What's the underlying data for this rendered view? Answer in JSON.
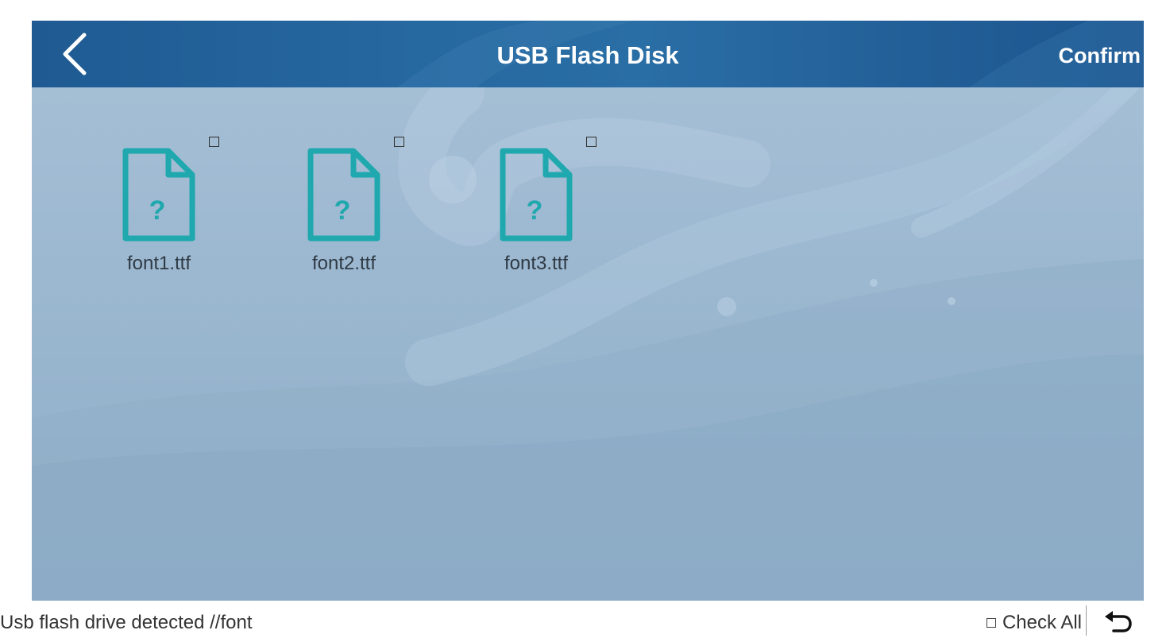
{
  "header": {
    "title": "USB Flash Disk",
    "confirm_label": "Confirm",
    "back_icon": "chevron-left-icon"
  },
  "files": [
    {
      "name": "font1.ttf",
      "icon": "unknown-file-icon",
      "checked": false
    },
    {
      "name": "font2.ttf",
      "icon": "unknown-file-icon",
      "checked": false
    },
    {
      "name": "font3.ttf",
      "icon": "unknown-file-icon",
      "checked": false
    }
  ],
  "status_bar": {
    "message": "Usb flash drive detected //font",
    "check_all_label": "Check All",
    "check_all_checked": false,
    "return_icon": "return-arrow-icon"
  },
  "colors": {
    "header": "#2464a0",
    "background": "#a3bdd3",
    "file_icon": "#1fa8ad",
    "text": "#2f3a44"
  }
}
